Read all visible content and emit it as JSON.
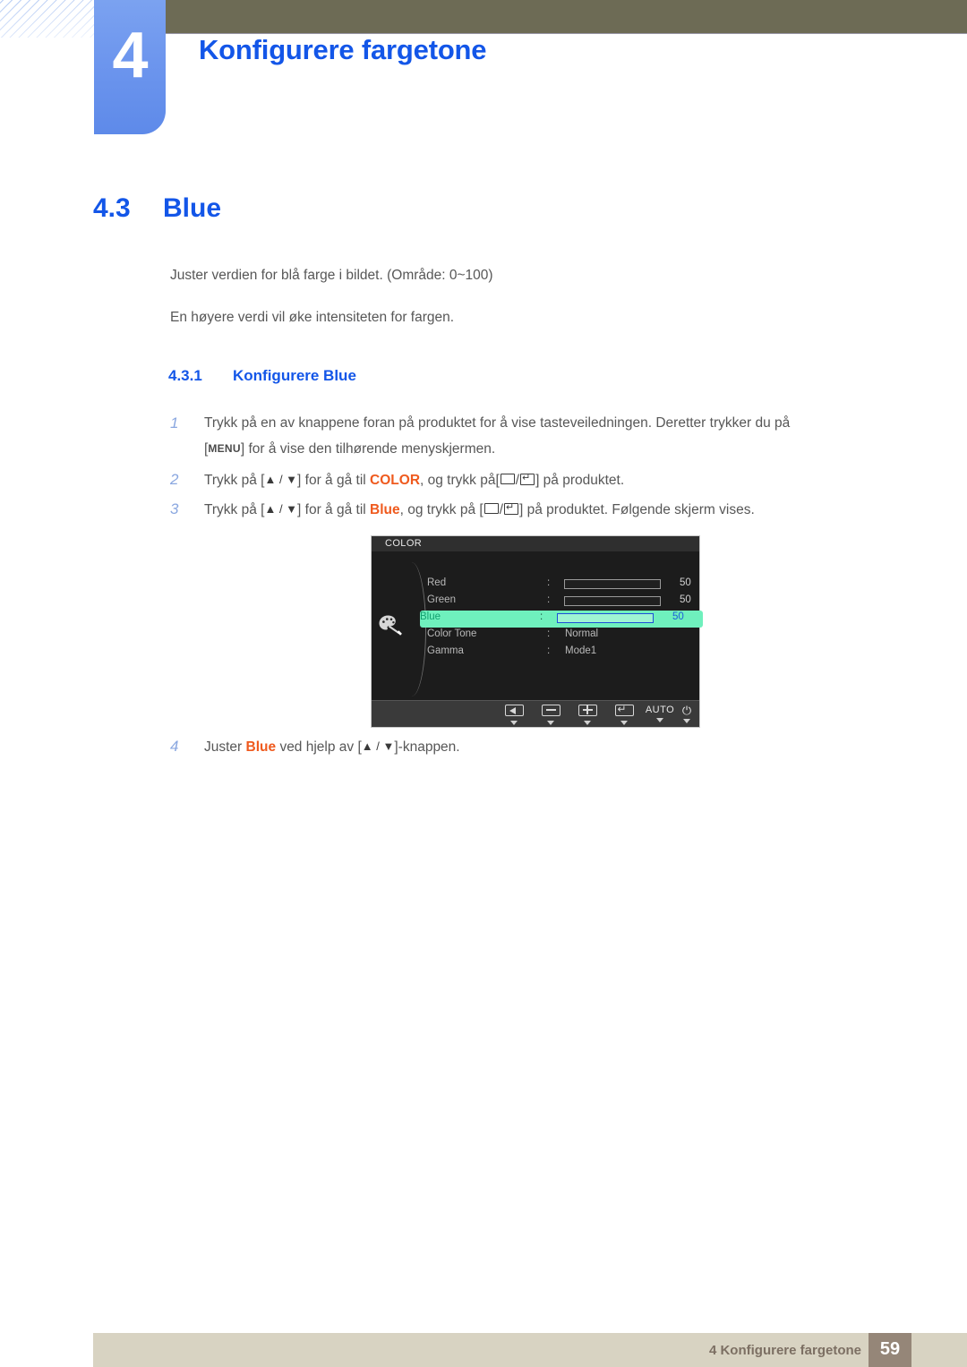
{
  "header": {
    "chapter_number": "4",
    "chapter_title": "Konfigurere fargetone"
  },
  "section": {
    "number": "4.3",
    "title": "Blue"
  },
  "intro": {
    "line1": "Juster verdien for blå farge i bildet. (Område: 0~100)",
    "line2": "En høyere verdi vil øke intensiteten for fargen."
  },
  "subsection": {
    "number": "4.3.1",
    "title": "Konfigurere Blue"
  },
  "steps": [
    {
      "index": "1",
      "part_a": "Trykk på en av knappene foran på produktet for å vise tasteveiledningen. Deretter trykker du på",
      "bracket_open": "[",
      "key": "MENU",
      "bracket_close": "]",
      "part_b": "for å vise den tilhørende menyskjermen."
    },
    {
      "index": "2",
      "part_a": "Trykk på [",
      "arrows": "▲ / ▼",
      "part_b": "] for å gå til",
      "keyword": "COLOR",
      "part_c": ", og trykk på[",
      "part_d": "] på produktet."
    },
    {
      "index": "3",
      "part_a": "Trykk på [",
      "arrows": "▲ / ▼",
      "part_b": "] for å gå til",
      "keyword": "Blue",
      "part_c": ", og trykk på [",
      "part_d": "] på produktet. Følgende skjerm vises."
    },
    {
      "index": "4",
      "part_a": "Juster",
      "keyword": "Blue",
      "part_b": "ved hjelp av [",
      "arrows": "▲ / ▼",
      "part_c": "]-knappen."
    }
  ],
  "osd": {
    "title": "COLOR",
    "icon": "palette-icon",
    "rows": [
      {
        "label": "Red",
        "colon": ":",
        "kind": "slider",
        "fill_percent": 50,
        "value": "50",
        "highlight": false
      },
      {
        "label": "Green",
        "colon": ":",
        "kind": "slider",
        "fill_percent": 50,
        "value": "50",
        "highlight": false
      },
      {
        "label": "Blue",
        "colon": ":",
        "kind": "slider",
        "fill_percent": 50,
        "value": "50",
        "highlight": true
      },
      {
        "label": "Color Tone",
        "colon": ":",
        "kind": "text",
        "value_text": "Normal",
        "highlight": false
      },
      {
        "label": "Gamma",
        "colon": ":",
        "kind": "text",
        "value_text": "Mode1",
        "highlight": false
      }
    ],
    "buttons": [
      {
        "name": "back-button",
        "glyph": "triangle-left"
      },
      {
        "name": "minus-button",
        "glyph": "minus"
      },
      {
        "name": "plus-button",
        "glyph": "plus"
      },
      {
        "name": "enter-button",
        "glyph": "enter-arrow"
      },
      {
        "name": "auto-button",
        "glyph": "text",
        "label": "AUTO"
      },
      {
        "name": "power-button",
        "glyph": "power",
        "label": "⏻"
      }
    ],
    "colors": {
      "panel_bg": "#1c1c1c",
      "titlebar_bg": "#2f2f2f",
      "highlight_bg": "#6ff0bd",
      "highlight_fill": "#1f5fe0",
      "slider_fill": "#a9b0b0"
    }
  },
  "footer": {
    "text": "4 Konfigurere fargetone",
    "page_number": "59"
  },
  "colors": {
    "heading_blue": "#1356e8",
    "badge_blue": "#6d96ee",
    "olive": "#6d6b55",
    "keyword_orange": "#ef5a1e",
    "body_gray": "#575757",
    "footer_beige": "#d8d3c2",
    "page_box_brown": "#958678"
  }
}
